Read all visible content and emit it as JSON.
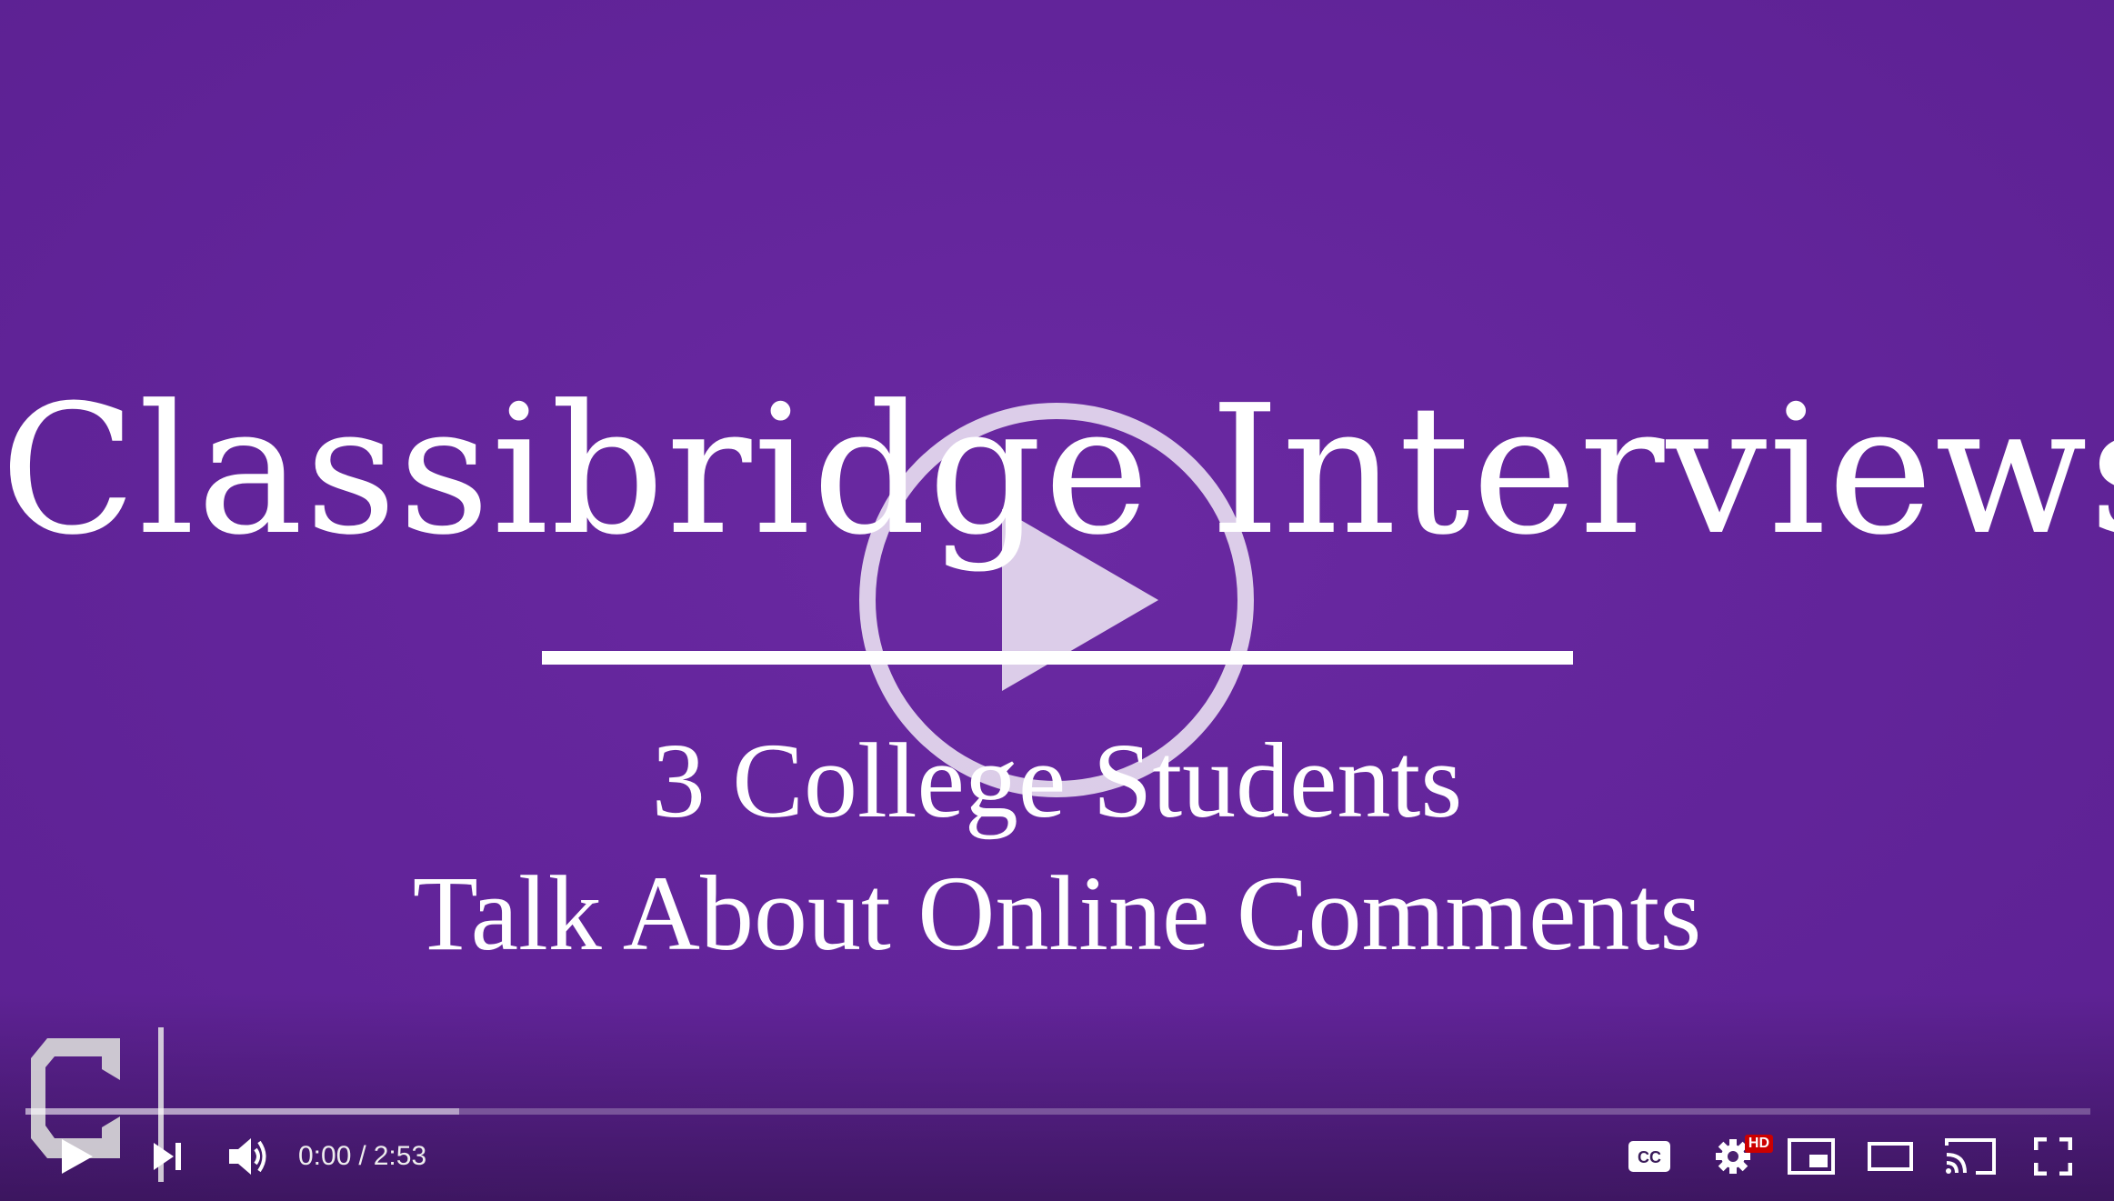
{
  "video": {
    "title": "Classibridge Interviews",
    "subtitle_line1": "3 College Students",
    "subtitle_line2": "Talk About Online Comments",
    "background_color": "#63259a"
  },
  "player": {
    "current_time": "0:00",
    "separator": "/",
    "duration": "2:53",
    "buffered_fraction": 0.21,
    "played_fraction": 0.0,
    "quality_badge": "HD",
    "icons": {
      "big_play": "play-circle-icon",
      "play": "play-icon",
      "next": "next-icon",
      "volume": "volume-icon",
      "captions": "cc-icon",
      "settings": "gear-icon",
      "miniplayer": "miniplayer-icon",
      "theater": "theater-mode-icon",
      "cast": "cast-icon",
      "fullscreen": "fullscreen-icon"
    },
    "accent_color": "#ff0000"
  }
}
